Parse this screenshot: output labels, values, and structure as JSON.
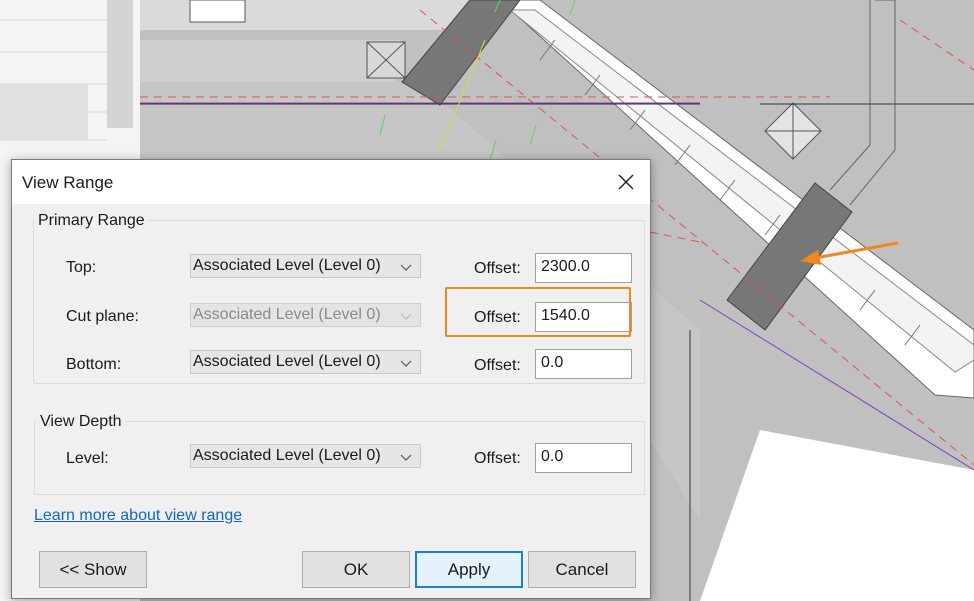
{
  "dialog": {
    "title": "View Range",
    "primary_range": {
      "legend": "Primary Range",
      "rows": [
        {
          "label": "Top:",
          "level": "Associated Level (Level 0)",
          "offset_label": "Offset:",
          "offset": "2300.0",
          "enabled": true
        },
        {
          "label": "Cut plane:",
          "level": "Associated Level (Level 0)",
          "offset_label": "Offset:",
          "offset": "1540.0",
          "enabled": false
        },
        {
          "label": "Bottom:",
          "level": "Associated Level (Level 0)",
          "offset_label": "Offset:",
          "offset": "0.0",
          "enabled": true
        }
      ]
    },
    "view_depth": {
      "legend": "View Depth",
      "row": {
        "label": "Level:",
        "level": "Associated Level (Level 0)",
        "offset_label": "Offset:",
        "offset": "0.0"
      }
    },
    "learn_more_link": "Learn more about view range",
    "buttons": {
      "show": "<< Show",
      "ok": "OK",
      "apply": "Apply",
      "cancel": "Cancel"
    }
  },
  "annotation": {
    "highlight_color": "#f0881f",
    "arrow_color": "#f0881f"
  },
  "icons": {
    "close": "close-icon",
    "dropdown": "chevron-down-icon"
  }
}
